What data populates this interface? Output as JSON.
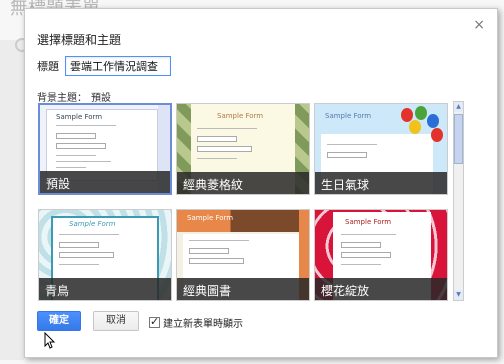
{
  "background": {
    "page_title": "無標題表單"
  },
  "dialog": {
    "title": "選擇標題和主題",
    "close_glyph": "×",
    "title_label": "標題",
    "title_value": "雲端工作情況調查",
    "theme_label": "背景主題：",
    "current_theme": "預設",
    "themes": [
      {
        "label": "預設",
        "selected": true
      },
      {
        "label": "經典菱格紋",
        "selected": false
      },
      {
        "label": "生日氣球",
        "selected": false
      },
      {
        "label": "青鳥",
        "selected": false
      },
      {
        "label": "經典圖書",
        "selected": false
      },
      {
        "label": "櫻花綻放",
        "selected": false
      }
    ],
    "preview_text": "Sample Form",
    "ok_label": "確定",
    "cancel_label": "取消",
    "checkbox_label": "建立新表單時顯示",
    "checkbox_checked": true
  },
  "colors": {
    "accent": "#4d90fe",
    "selected_border": "#6b8dd8"
  }
}
